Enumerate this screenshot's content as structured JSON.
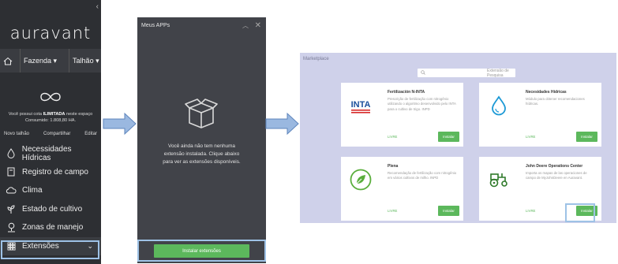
{
  "colors": {
    "sidebar_bg": "#2d2f33",
    "panel_bg": "#414349",
    "market_bg": "#cfd1ea",
    "accent_green": "#5cb85c",
    "highlight": "#9ec2e6",
    "arrow": "#7ea6d8"
  },
  "sidebar": {
    "logo": "auravant",
    "breadcrumb": {
      "farm": "Fazenda ▾",
      "field": "Talhão ▾"
    },
    "quota_line1_pre": "Você possui cota ",
    "quota_line1_bold": "ILIMITADA",
    "quota_line1_post": " neste espaço",
    "quota_line2": "Consumido: 1.808,80 HA.",
    "actions": [
      "Novo talhão",
      "Compartilhar",
      "Editar"
    ],
    "menu": [
      {
        "label": "Necessidades Hídricas",
        "icon": "water-drop-icon"
      },
      {
        "label": "Registro de campo",
        "icon": "field-record-icon"
      },
      {
        "label": "Clima",
        "icon": "cloud-icon"
      },
      {
        "label": "Estado de cultivo",
        "icon": "crop-state-icon"
      },
      {
        "label": "Zonas de manejo",
        "icon": "location-pin-icon"
      },
      {
        "label": "Extensões",
        "icon": "extensions-grid-icon"
      }
    ]
  },
  "apps_panel": {
    "title": "Meus APPs",
    "empty_text_1": "Você ainda não tem nenhuma",
    "empty_text_2": "extensão instalada. Clique abaixo",
    "empty_text_3": "para ver as extensões disponíveis.",
    "install_button": "Instalar extensões"
  },
  "marketplace": {
    "title": "Marketplace",
    "search_placeholder": "Extensão de Pesquisa",
    "cards": [
      {
        "title": "Fertilización N-INTA",
        "desc": "Prescrição de fertilização com nitrogênio utilizando o algoritmo desenvolvido pelo INTA para o cultivo de trigo. INPD",
        "price": "LIVRE",
        "button": "Instalar",
        "logo_text": "INTA"
      },
      {
        "title": "Necesidades Hídricas",
        "desc": "Módulo para obtener recomendaciones hídricas.",
        "price": "LIVRE",
        "button": "Instalar"
      },
      {
        "title": "Plena",
        "desc": "Recomendação de fertilização com nitrogênio em vários cultivos de milho. INPD",
        "price": "LIVRE",
        "button": "Instalar"
      },
      {
        "title": "John Deere Operations Center",
        "desc": "Importa os mapas de las operaciones de campo de MyJohnDeere en Auravant.",
        "price": "LIVRE",
        "button": "Instalar"
      }
    ]
  }
}
